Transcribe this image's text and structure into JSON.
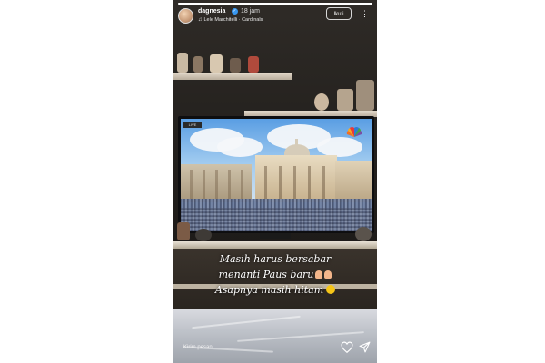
{
  "story": {
    "progress": 1.0,
    "username": "dagnesia",
    "verified_icon": "verified-badge-icon",
    "time_ago": "18 jam",
    "music_icon": "music-note-icon",
    "music": "Lele Marchitelli · Cardinals",
    "follow_label": "Ikuti",
    "more_icon": "more-options-icon"
  },
  "tv": {
    "channel_badge": "LIVE",
    "logo_icon": "nbc-peacock-icon"
  },
  "caption": {
    "line1": "Masih harus bersabar",
    "line2": "menanti Paus baru",
    "line3": "Asapnya masih hitam"
  },
  "footer": {
    "message_placeholder": "Kirim pesan",
    "heart_icon": "heart-icon",
    "send_icon": "send-icon"
  },
  "colors": {
    "story_bg": "#26221f",
    "follow_border": "#d8d8d8",
    "verified": "#3897f0"
  }
}
